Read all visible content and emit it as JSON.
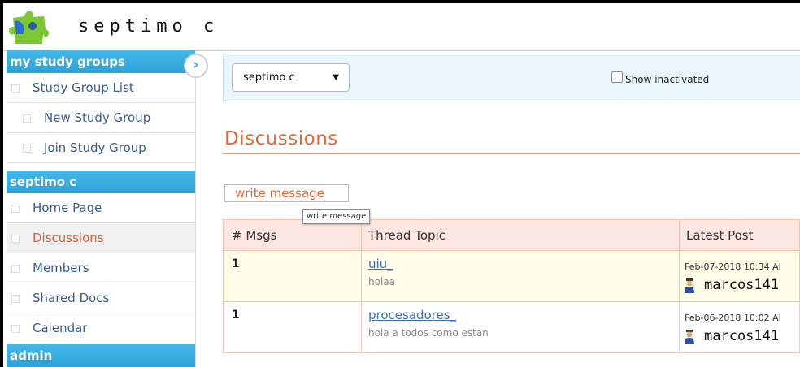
{
  "app": {
    "title": "septimo c"
  },
  "sidebar": {
    "sections": [
      {
        "title": "my study groups",
        "items": [
          {
            "label": "Study Group List"
          },
          {
            "label": "New Study Group"
          },
          {
            "label": "Join Study Group"
          }
        ]
      },
      {
        "title": "septimo c",
        "items": [
          {
            "label": "Home Page"
          },
          {
            "label": "Discussions",
            "active": true
          },
          {
            "label": "Members"
          },
          {
            "label": "Shared Docs"
          },
          {
            "label": "Calendar"
          }
        ]
      },
      {
        "title": "admin",
        "items": []
      }
    ],
    "collapse_icon": "chevron-right-icon"
  },
  "toolbar": {
    "group_select": "septimo c",
    "show_inactivated_label": "Show inactivated",
    "show_inactivated_checked": false
  },
  "main": {
    "title": "Discussions",
    "write_button": "write message",
    "tooltip": "write message"
  },
  "table": {
    "headers": [
      "# Msgs",
      "Thread Topic",
      "Latest Post"
    ],
    "rows": [
      {
        "msgs": "1",
        "topic": "uiu_",
        "preview": "holaa",
        "date": "Feb-07-2018 10:34 AI",
        "user": "marcos141"
      },
      {
        "msgs": "1",
        "topic": "procesadores_",
        "preview": "hola a todos como estan",
        "date": "Feb-06-2018 10:02 AI",
        "user": "marcos141"
      }
    ]
  },
  "colors": {
    "accent": "#e3673a",
    "section_header": "#2ba2d8",
    "link": "#3a6fbf",
    "row_alt": "#fffce8"
  }
}
